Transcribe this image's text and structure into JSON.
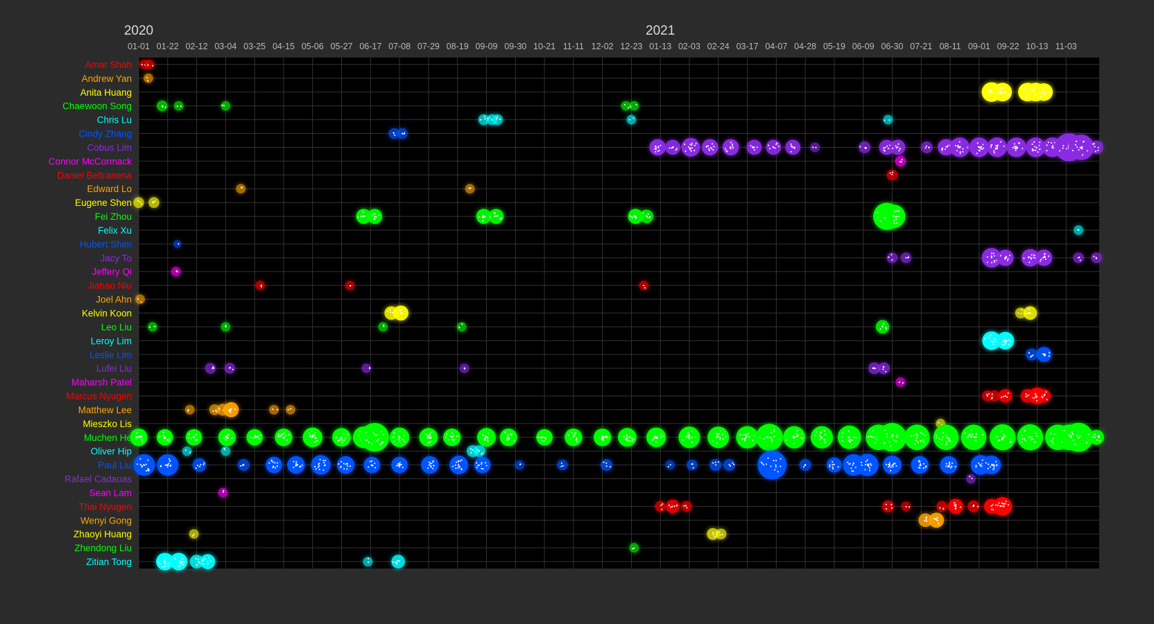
{
  "chart_data": {
    "type": "scatter",
    "title": "",
    "xlabel": "",
    "ylabel": "",
    "grid": true,
    "legend": "none",
    "background_color": "#000000",
    "grid_color": "#333333",
    "page_color": "#2b2b2b",
    "tick_color": "#b8b8b8",
    "year_labels": [
      {
        "label": "2020",
        "date": "2020-01-01"
      },
      {
        "label": "2021",
        "date": "2021-01-13"
      }
    ],
    "x_ticks": [
      "01-01",
      "01-22",
      "02-12",
      "03-04",
      "03-25",
      "04-15",
      "05-06",
      "05-27",
      "06-17",
      "07-08",
      "07-29",
      "08-19",
      "09-09",
      "09-30",
      "10-21",
      "11-11",
      "12-02",
      "12-23",
      "01-13",
      "02-03",
      "02-24",
      "03-17",
      "04-07",
      "04-28",
      "05-19",
      "06-09",
      "06-30",
      "07-21",
      "08-11",
      "09-01",
      "09-22",
      "10-13",
      "11-03"
    ],
    "xlim": [
      "2020-01-01",
      "2021-11-27"
    ],
    "color_cycle": [
      "#ff0000",
      "#ffa500",
      "#ffff00",
      "#00ff00",
      "#00ffff",
      "#0055ff",
      "#8a2be2",
      "#ff00ff"
    ],
    "people": [
      {
        "name": "Amar Shah",
        "color": "#ff0000",
        "dots": [
          [
            "2020-01-05",
            2
          ],
          [
            "2020-01-09",
            2
          ]
        ]
      },
      {
        "name": "Andrew Yan",
        "color": "#ffa500",
        "dots": [
          [
            "2020-01-08",
            2
          ]
        ]
      },
      {
        "name": "Anita Huang",
        "color": "#ffff00",
        "dots": [
          [
            "2021-09-10",
            16
          ],
          [
            "2021-09-18",
            14
          ],
          [
            "2021-10-06",
            14
          ],
          [
            "2021-10-12",
            14
          ],
          [
            "2021-10-18",
            12
          ]
        ]
      },
      {
        "name": "Chaewoon Song",
        "color": "#00ff00",
        "dots": [
          [
            "2020-01-18",
            3
          ],
          [
            "2020-01-30",
            2
          ],
          [
            "2020-03-04",
            2
          ],
          [
            "2020-12-19",
            2
          ],
          [
            "2020-12-25",
            2
          ]
        ]
      },
      {
        "name": "Chris Lu",
        "color": "#00ffff",
        "dots": [
          [
            "2020-09-07",
            3
          ],
          [
            "2020-09-13",
            3
          ],
          [
            "2020-09-17",
            3
          ],
          [
            "2020-12-23",
            2
          ],
          [
            "2021-06-27",
            2
          ]
        ]
      },
      {
        "name": "Cindy Zhang",
        "color": "#0055ff",
        "dots": [
          [
            "2020-07-04",
            3
          ],
          [
            "2020-07-10",
            3
          ]
        ]
      },
      {
        "name": "Cobus Lim",
        "color": "#8a2be2",
        "dots": [
          [
            "2021-01-11",
            10
          ],
          [
            "2021-01-22",
            8
          ],
          [
            "2021-02-04",
            14
          ],
          [
            "2021-02-18",
            10
          ],
          [
            "2021-03-05",
            10
          ],
          [
            "2021-03-22",
            8
          ],
          [
            "2021-04-05",
            8
          ],
          [
            "2021-04-19",
            8
          ],
          [
            "2021-05-05",
            2
          ],
          [
            "2021-06-10",
            4
          ],
          [
            "2021-06-26",
            8
          ],
          [
            "2021-07-04",
            8
          ],
          [
            "2021-07-25",
            4
          ],
          [
            "2021-08-08",
            10
          ],
          [
            "2021-08-18",
            16
          ],
          [
            "2021-09-01",
            16
          ],
          [
            "2021-09-14",
            16
          ],
          [
            "2021-09-28",
            16
          ],
          [
            "2021-10-12",
            16
          ],
          [
            "2021-10-24",
            16
          ],
          [
            "2021-11-05",
            38
          ],
          [
            "2021-11-14",
            30
          ],
          [
            "2021-11-25",
            6
          ]
        ]
      },
      {
        "name": "Connor McCormack",
        "color": "#ff00ff",
        "dots": [
          [
            "2021-07-06",
            3
          ]
        ]
      },
      {
        "name": "Daniel Beltranena",
        "color": "#ff0000",
        "dots": [
          [
            "2021-06-30",
            3
          ]
        ]
      },
      {
        "name": "Edward Lo",
        "color": "#ffa500",
        "dots": [
          [
            "2020-03-15",
            2
          ],
          [
            "2020-08-28",
            2
          ]
        ]
      },
      {
        "name": "Eugene Shen",
        "color": "#ffff00",
        "dots": [
          [
            "2020-01-01",
            3
          ],
          [
            "2020-01-12",
            3
          ]
        ]
      },
      {
        "name": "Fei Zhou",
        "color": "#00ff00",
        "dots": [
          [
            "2020-06-12",
            8
          ],
          [
            "2020-06-20",
            8
          ],
          [
            "2020-09-07",
            8
          ],
          [
            "2020-09-16",
            8
          ],
          [
            "2020-12-26",
            8
          ],
          [
            "2021-01-03",
            6
          ],
          [
            "2021-06-26",
            35
          ],
          [
            "2021-07-01",
            25
          ]
        ]
      },
      {
        "name": "Felix Xu",
        "color": "#00ffff",
        "dots": [
          [
            "2021-11-12",
            2
          ]
        ]
      },
      {
        "name": "Hubert Shim",
        "color": "#0055ff",
        "dots": [
          [
            "2020-01-29",
            1
          ]
        ]
      },
      {
        "name": "Jacy To",
        "color": "#8a2be2",
        "dots": [
          [
            "2021-06-30",
            3
          ],
          [
            "2021-07-10",
            3
          ],
          [
            "2021-09-10",
            16
          ],
          [
            "2021-09-20",
            10
          ],
          [
            "2021-10-08",
            12
          ],
          [
            "2021-10-18",
            10
          ],
          [
            "2021-11-12",
            3
          ],
          [
            "2021-11-25",
            3
          ]
        ]
      },
      {
        "name": "Jeffery Qi",
        "color": "#ff00ff",
        "dots": [
          [
            "2020-01-28",
            2
          ]
        ]
      },
      {
        "name": "Jiahao Niu",
        "color": "#ff0000",
        "dots": [
          [
            "2020-03-29",
            2
          ],
          [
            "2020-06-02",
            2
          ],
          [
            "2021-01-01",
            2
          ]
        ]
      },
      {
        "name": "Joel Ahn",
        "color": "#ffa500",
        "dots": [
          [
            "2020-01-02",
            2
          ]
        ]
      },
      {
        "name": "Kelvin Koon",
        "color": "#ffff00",
        "dots": [
          [
            "2020-07-02",
            6
          ],
          [
            "2020-07-09",
            8
          ],
          [
            "2021-10-01",
            3
          ],
          [
            "2021-10-08",
            6
          ]
        ]
      },
      {
        "name": "Leo Liu",
        "color": "#00ff00",
        "dots": [
          [
            "2020-01-11",
            2
          ],
          [
            "2020-03-04",
            2
          ],
          [
            "2020-06-26",
            2
          ],
          [
            "2020-08-22",
            2
          ],
          [
            "2021-06-23",
            6
          ]
        ]
      },
      {
        "name": "Leroy Lim",
        "color": "#00ffff",
        "dots": [
          [
            "2021-09-10",
            14
          ],
          [
            "2021-09-20",
            12
          ]
        ]
      },
      {
        "name": "Leslie Lim",
        "color": "#0055ff",
        "dots": [
          [
            "2021-10-09",
            4
          ],
          [
            "2021-10-18",
            8
          ]
        ]
      },
      {
        "name": "Lufei Liu",
        "color": "#8a2be2",
        "dots": [
          [
            "2020-02-22",
            3
          ],
          [
            "2020-03-07",
            3
          ],
          [
            "2020-06-14",
            2
          ],
          [
            "2020-08-24",
            2
          ],
          [
            "2021-06-17",
            4
          ],
          [
            "2021-06-24",
            4
          ]
        ]
      },
      {
        "name": "Maharsh Patel",
        "color": "#ff00ff",
        "dots": [
          [
            "2021-07-06",
            2
          ]
        ]
      },
      {
        "name": "Marcus Nyugen",
        "color": "#ff0000",
        "dots": [
          [
            "2021-09-07",
            3
          ],
          [
            "2021-09-12",
            3
          ],
          [
            "2021-09-20",
            6
          ],
          [
            "2021-10-06",
            6
          ],
          [
            "2021-10-13",
            10
          ],
          [
            "2021-10-18",
            6
          ]
        ]
      },
      {
        "name": "Matthew Lee",
        "color": "#ffa500",
        "dots": [
          [
            "2020-02-07",
            2
          ],
          [
            "2020-02-25",
            3
          ],
          [
            "2020-03-02",
            4
          ],
          [
            "2020-03-08",
            8
          ],
          [
            "2020-04-08",
            2
          ],
          [
            "2020-04-20",
            2
          ]
        ]
      },
      {
        "name": "Mieszko Lis",
        "color": "#ffff00",
        "dots": [
          [
            "2021-08-04",
            2
          ]
        ]
      },
      {
        "name": "Muchen He",
        "color": "#00ff00",
        "dots": [
          [
            "2020-01-01",
            12
          ],
          [
            "2020-01-20",
            10
          ],
          [
            "2020-02-10",
            10
          ],
          [
            "2020-03-05",
            12
          ],
          [
            "2020-03-25",
            10
          ],
          [
            "2020-04-15",
            12
          ],
          [
            "2020-05-06",
            16
          ],
          [
            "2020-05-27",
            14
          ],
          [
            "2020-06-12",
            20
          ],
          [
            "2020-06-20",
            40
          ],
          [
            "2020-07-08",
            16
          ],
          [
            "2020-07-29",
            14
          ],
          [
            "2020-08-15",
            12
          ],
          [
            "2020-09-09",
            14
          ],
          [
            "2020-09-25",
            12
          ],
          [
            "2020-10-21",
            10
          ],
          [
            "2020-11-11",
            12
          ],
          [
            "2020-12-02",
            12
          ],
          [
            "2020-12-20",
            14
          ],
          [
            "2021-01-10",
            16
          ],
          [
            "2021-02-03",
            20
          ],
          [
            "2021-02-24",
            20
          ],
          [
            "2021-03-17",
            22
          ],
          [
            "2021-04-02",
            35
          ],
          [
            "2021-04-20",
            22
          ],
          [
            "2021-05-10",
            22
          ],
          [
            "2021-05-30",
            25
          ],
          [
            "2021-06-20",
            30
          ],
          [
            "2021-06-30",
            40
          ],
          [
            "2021-07-18",
            30
          ],
          [
            "2021-08-08",
            30
          ],
          [
            "2021-08-28",
            30
          ],
          [
            "2021-09-18",
            32
          ],
          [
            "2021-10-08",
            32
          ],
          [
            "2021-10-28",
            30
          ],
          [
            "2021-11-05",
            30
          ],
          [
            "2021-11-12",
            45
          ],
          [
            "2021-11-25",
            8
          ]
        ]
      },
      {
        "name": "Oliver Hip",
        "color": "#00ffff",
        "dots": [
          [
            "2020-02-05",
            2
          ],
          [
            "2020-03-04",
            2
          ],
          [
            "2020-08-30",
            4
          ],
          [
            "2020-09-04",
            4
          ]
        ]
      },
      {
        "name": "Paul Liu",
        "color": "#0055ff",
        "dots": [
          [
            "2020-01-05",
            20
          ],
          [
            "2020-01-22",
            20
          ],
          [
            "2020-02-14",
            6
          ],
          [
            "2020-03-17",
            4
          ],
          [
            "2020-04-08",
            10
          ],
          [
            "2020-04-24",
            12
          ],
          [
            "2020-05-12",
            16
          ],
          [
            "2020-05-30",
            12
          ],
          [
            "2020-06-18",
            10
          ],
          [
            "2020-07-08",
            10
          ],
          [
            "2020-07-30",
            12
          ],
          [
            "2020-08-20",
            14
          ],
          [
            "2020-09-06",
            10
          ],
          [
            "2020-10-03",
            2
          ],
          [
            "2020-11-03",
            3
          ],
          [
            "2020-12-05",
            4
          ],
          [
            "2021-01-20",
            2
          ],
          [
            "2021-02-05",
            3
          ],
          [
            "2021-02-22",
            4
          ],
          [
            "2021-03-04",
            4
          ],
          [
            "2021-04-04",
            45
          ],
          [
            "2021-04-28",
            4
          ],
          [
            "2021-05-19",
            8
          ],
          [
            "2021-06-02",
            20
          ],
          [
            "2021-06-12",
            22
          ],
          [
            "2021-06-30",
            14
          ],
          [
            "2021-07-20",
            12
          ],
          [
            "2021-08-10",
            12
          ],
          [
            "2021-09-02",
            16
          ],
          [
            "2021-09-10",
            14
          ]
        ]
      },
      {
        "name": "Rafael Cadaoas",
        "color": "#8a2be2",
        "dots": [
          [
            "2021-08-26",
            2
          ]
        ]
      },
      {
        "name": "Sean Lam",
        "color": "#ff00ff",
        "dots": [
          [
            "2020-03-02",
            2
          ]
        ]
      },
      {
        "name": "Thai Nyugen",
        "color": "#ff0000",
        "dots": [
          [
            "2021-01-13",
            3
          ],
          [
            "2021-01-22",
            6
          ],
          [
            "2021-02-01",
            3
          ],
          [
            "2021-06-27",
            4
          ],
          [
            "2021-07-10",
            2
          ],
          [
            "2021-08-05",
            3
          ],
          [
            "2021-08-15",
            8
          ],
          [
            "2021-08-28",
            4
          ],
          [
            "2021-09-10",
            8
          ],
          [
            "2021-09-18",
            14
          ]
        ]
      },
      {
        "name": "Wenyi Gong",
        "color": "#ffa500",
        "dots": [
          [
            "2021-07-24",
            6
          ],
          [
            "2021-08-01",
            8
          ]
        ]
      },
      {
        "name": "Zhaoyi Huang",
        "color": "#ffff00",
        "dots": [
          [
            "2020-02-10",
            2
          ],
          [
            "2021-02-20",
            4
          ],
          [
            "2021-02-26",
            3
          ]
        ]
      },
      {
        "name": "Zhendong Liu",
        "color": "#00ff00",
        "dots": [
          [
            "2020-12-25",
            2
          ]
        ]
      },
      {
        "name": "Zitian Tong",
        "color": "#00ffff",
        "dots": [
          [
            "2020-01-20",
            12
          ],
          [
            "2020-01-30",
            12
          ],
          [
            "2020-02-12",
            6
          ],
          [
            "2020-02-20",
            8
          ],
          [
            "2020-06-15",
            2
          ],
          [
            "2020-07-07",
            6
          ]
        ]
      }
    ]
  }
}
